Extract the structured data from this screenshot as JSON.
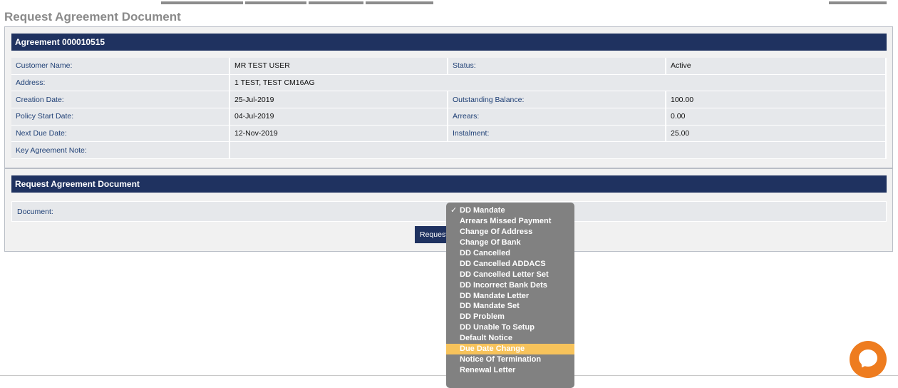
{
  "page": {
    "title": "Request Agreement Document"
  },
  "agreement_panel": {
    "header": "Agreement 000010515",
    "rows": [
      {
        "label1": "Customer Name:",
        "value1": "MR TEST USER",
        "label2": "Status:",
        "value2": "Active"
      },
      {
        "label1": "Address:",
        "value1": "1 TEST, TEST CM16AG",
        "label2": "",
        "value2": ""
      },
      {
        "label1": "Creation Date:",
        "value1": "25-Jul-2019",
        "label2": "Outstanding Balance:",
        "value2": "100.00"
      },
      {
        "label1": "Policy Start Date:",
        "value1": "04-Jul-2019",
        "label2": "Arrears:",
        "value2": "0.00"
      },
      {
        "label1": "Next Due Date:",
        "value1": "12-Nov-2019",
        "label2": "Instalment:",
        "value2": "25.00"
      },
      {
        "label1": "Key Agreement Note:",
        "value1": "",
        "label2": "",
        "value2": ""
      }
    ]
  },
  "request_panel": {
    "header": "Request Agreement Document",
    "document_label": "Document:",
    "request_button": "Request"
  },
  "document_dropdown": {
    "check_mark": "✓",
    "selected_index": 0,
    "highlighted_index": 13,
    "options": [
      "DD Mandate",
      "Arrears Missed Payment",
      "Change Of Address",
      "Change Of Bank",
      "DD Cancelled",
      "DD Cancelled ADDACS",
      "DD Cancelled Letter Set",
      "DD Incorrect Bank Dets",
      "DD Mandate Letter",
      "DD Mandate Set",
      "DD Problem",
      "DD Unable To Setup",
      "Default Notice",
      "Due Date Change",
      "Notice Of Termination",
      "Renewal Letter"
    ]
  },
  "colors": {
    "header_navy": "#1f3260",
    "label_blue": "#1e3f75",
    "highlight": "#f7c35b",
    "chat_orange": "#ee7c1f"
  },
  "icons": {
    "chat": "chat-bubble-icon",
    "check": "check-icon"
  }
}
